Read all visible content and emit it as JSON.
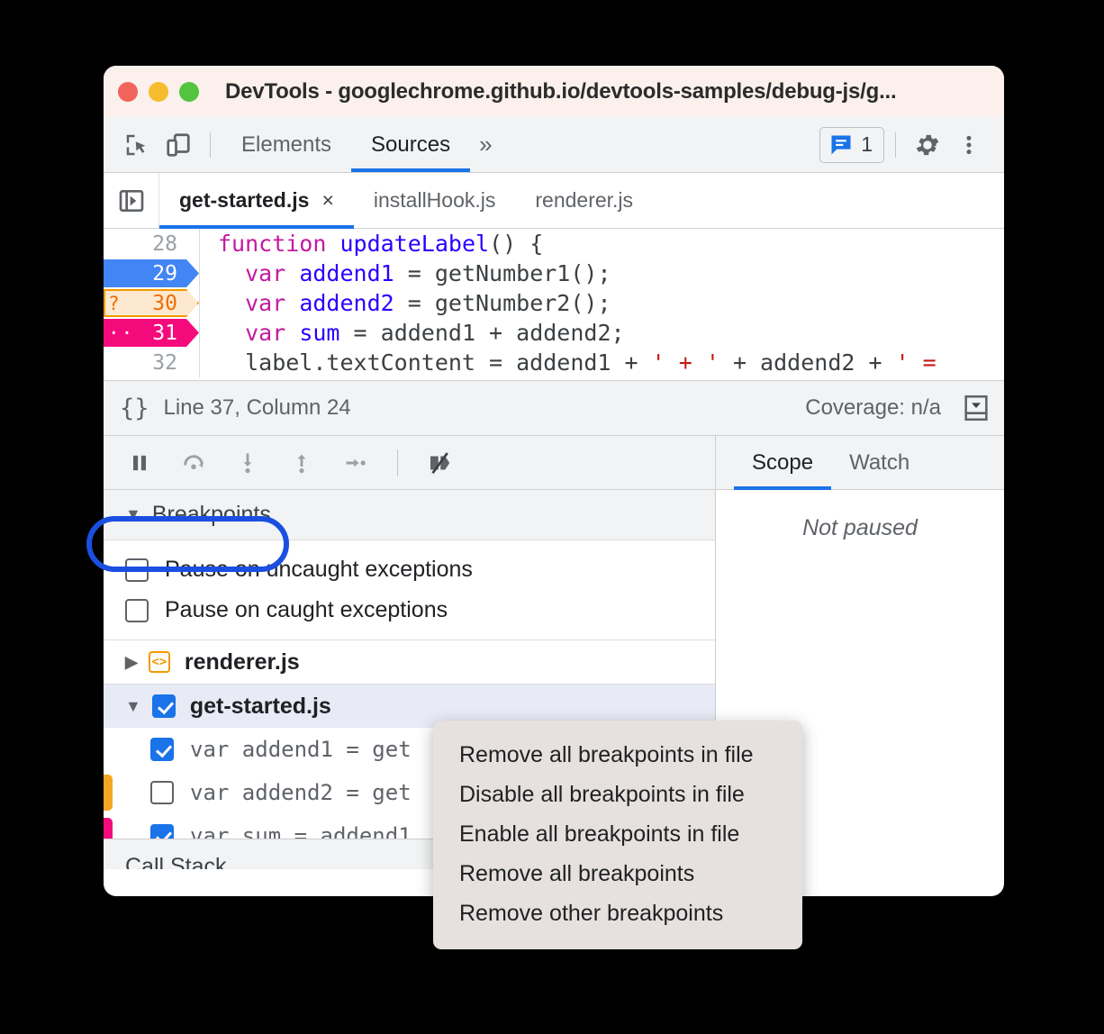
{
  "window": {
    "title": "DevTools - googlechrome.github.io/devtools-samples/debug-js/g...",
    "traffic_lights": [
      "close-red",
      "minimize-yellow",
      "maximize-green"
    ]
  },
  "toolbar": {
    "inspect_icon": "inspect-element-icon",
    "device_icon": "device-toolbar-icon",
    "panels": [
      {
        "label": "Elements",
        "active": false
      },
      {
        "label": "Sources",
        "active": true
      }
    ],
    "more_panels": "»",
    "issues": {
      "icon": "issues-message-icon",
      "count": "1"
    },
    "settings_icon": "gear-icon",
    "more_icon": "kebab-menu-icon"
  },
  "file_tabs": {
    "navigator_toggle_icon": "show-navigator-icon",
    "tabs": [
      {
        "label": "get-started.js",
        "active": true,
        "close": "×"
      },
      {
        "label": "installHook.js",
        "active": false
      },
      {
        "label": "renderer.js",
        "active": false
      }
    ]
  },
  "editor": {
    "lines": [
      {
        "number": "28",
        "marker": "none",
        "badge": "",
        "code": "function updateLabel() {"
      },
      {
        "number": "29",
        "marker": "blue",
        "badge": "",
        "code": "  var addend1 = getNumber1();"
      },
      {
        "number": "30",
        "marker": "orange",
        "badge": "?",
        "code": "  var addend2 = getNumber2();"
      },
      {
        "number": "31",
        "marker": "pink",
        "badge": "··",
        "code": "  var sum = addend1 + addend2;"
      },
      {
        "number": "32",
        "marker": "none",
        "badge": "",
        "code": "  label.textContent = addend1 + ' + ' + addend2 + ' ="
      }
    ]
  },
  "status_bar": {
    "format_icon": "pretty-print-braces-icon",
    "position": "Line 37, Column 24",
    "coverage": "Coverage: n/a",
    "drawer_icon": "show-drawer-icon"
  },
  "debugger_toolbar": {
    "buttons": [
      {
        "name": "pause-resume-button",
        "icon": "pause-icon"
      },
      {
        "name": "step-over-button",
        "icon": "step-over-icon"
      },
      {
        "name": "step-into-button",
        "icon": "step-into-icon"
      },
      {
        "name": "step-out-button",
        "icon": "step-out-icon"
      },
      {
        "name": "step-button",
        "icon": "step-icon"
      },
      {
        "name": "deactivate-breakpoints-button",
        "icon": "deactivate-breakpoints-icon"
      }
    ]
  },
  "breakpoints_panel": {
    "section_title": "Breakpoints",
    "collapse_arrow": "▼",
    "highlighted": true,
    "pause_options": [
      {
        "label": "Pause on uncaught exceptions",
        "checked": false
      },
      {
        "label": "Pause on caught exceptions",
        "checked": false
      }
    ],
    "files": [
      {
        "name": "renderer.js",
        "expanded": false,
        "arrow": "▶",
        "icon": "code-file-icon",
        "checked": null,
        "selected": false,
        "items": []
      },
      {
        "name": "get-started.js",
        "expanded": true,
        "arrow": "▼",
        "icon": null,
        "checked": true,
        "selected": true,
        "items": [
          {
            "label": "var addend1 = get",
            "checked": true,
            "edge_marker": "none"
          },
          {
            "label": "var addend2 = get",
            "checked": false,
            "edge_marker": "orange"
          },
          {
            "label": "var sum = addend1",
            "checked": true,
            "edge_marker": "pink"
          }
        ]
      }
    ],
    "call_stack_label": "Call Stack"
  },
  "scope_panel": {
    "tabs": [
      {
        "label": "Scope",
        "active": true
      },
      {
        "label": "Watch",
        "active": false
      }
    ],
    "empty_message": "Not paused"
  },
  "context_menu": {
    "items": [
      "Remove all breakpoints in file",
      "Disable all breakpoints in file",
      "Enable all breakpoints in file",
      "Remove all breakpoints",
      "Remove other breakpoints"
    ]
  },
  "colors": {
    "accent_blue": "#1a73e8",
    "breakpoint_blue": "#4285f4",
    "breakpoint_orange": "#f29900",
    "breakpoint_pink": "#f50a7c",
    "highlight_ring": "#1a4fe0",
    "keyword": "#c41a9f",
    "identifier": "#2a00ff",
    "string": "#c41a16"
  }
}
